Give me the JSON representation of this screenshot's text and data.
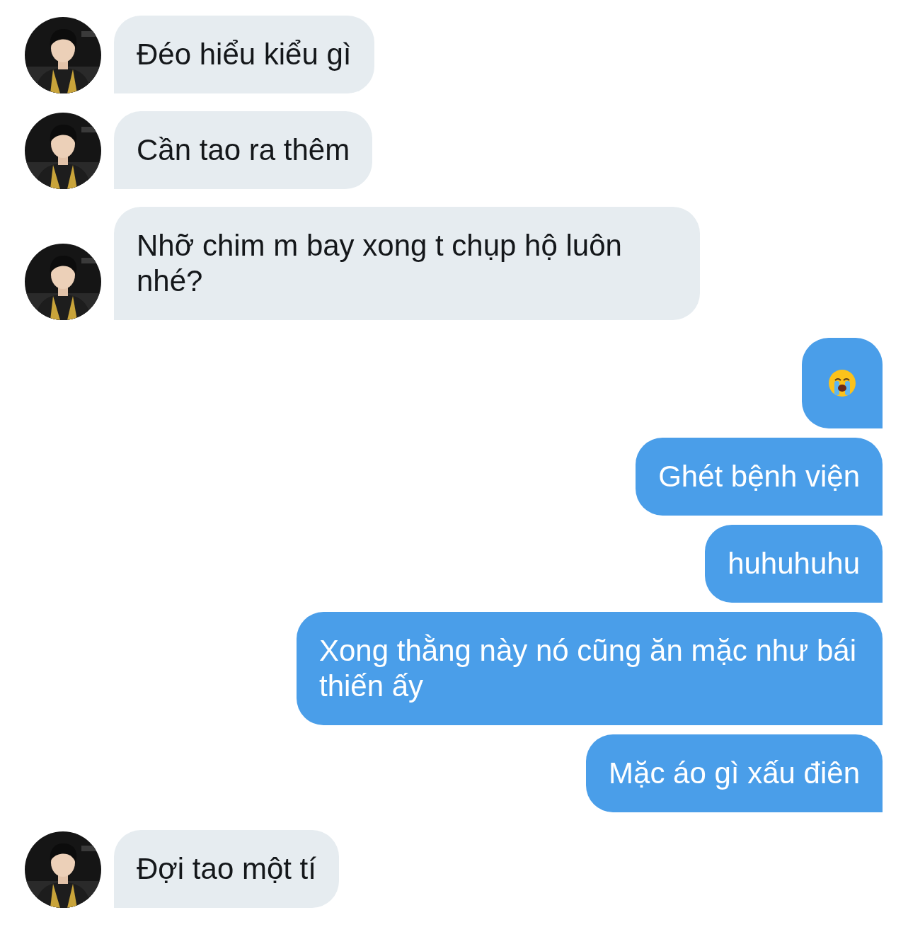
{
  "messages": [
    {
      "sent": false,
      "kind": "text",
      "text": "Đéo hiểu kiểu gì"
    },
    {
      "sent": false,
      "kind": "text",
      "text": "Cần tao ra thêm"
    },
    {
      "sent": false,
      "kind": "text",
      "text": "Nhỡ chim m bay xong t chụp hộ luôn nhé?"
    },
    {
      "sent": true,
      "kind": "emoji"
    },
    {
      "sent": true,
      "kind": "text",
      "text": "Ghét bệnh viện"
    },
    {
      "sent": true,
      "kind": "text",
      "text": "huhuhuhu"
    },
    {
      "sent": true,
      "kind": "text",
      "text": "Xong thằng này nó cũng ăn mặc như bái thiến ấy"
    },
    {
      "sent": true,
      "kind": "text",
      "text": "Mặc áo gì xấu điên"
    },
    {
      "sent": false,
      "kind": "text",
      "text": "Đợi tao một tí"
    }
  ]
}
